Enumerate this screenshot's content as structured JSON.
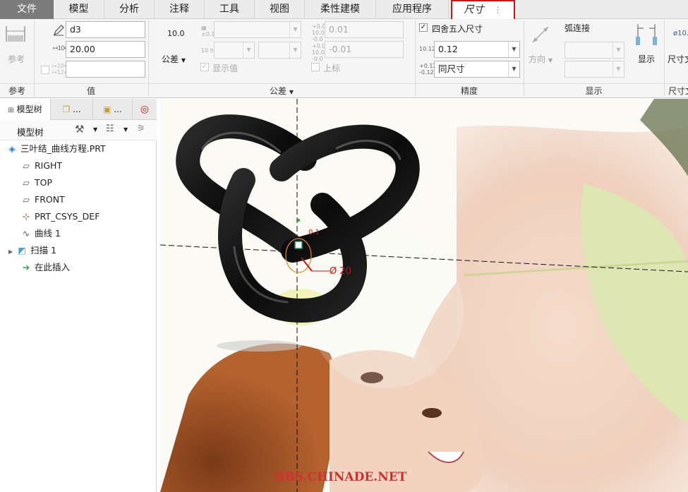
{
  "tabs": {
    "file": "文件",
    "model": "模型",
    "analysis": "分析",
    "annotate": "注释",
    "tools": "工具",
    "view": "视图",
    "flexible": "柔性建模",
    "apps": "应用程序",
    "dimension": "尺寸",
    "more": "⋮"
  },
  "ribbon": {
    "reference": {
      "button": "参考",
      "group": "参考"
    },
    "value": {
      "name": "d3",
      "value": "20.00",
      "group": "值"
    },
    "tolerance": {
      "nominal": "10.0",
      "button": "公差",
      "upper": "0.01",
      "lower": "-0.01",
      "show_value": "显示值",
      "upper_label": "上标",
      "group": "公差"
    },
    "precision": {
      "round_label": "四舍五入尺寸",
      "decimals": "0.12",
      "tol_decimals": "同尺寸",
      "group": "精度",
      "ico_a": "10.123",
      "ico_b": "+0.123\n-0.123"
    },
    "display": {
      "direction": "方向",
      "arc": "弧连接",
      "show_button": "显示",
      "group": "显示"
    },
    "dimtext": {
      "button": "尺寸文",
      "group": "尺寸文"
    }
  },
  "panel": {
    "tab_model_tree": "模型树",
    "tab2": "...",
    "tab3": "...",
    "toolbar_title": "模型树",
    "tree": [
      {
        "label": "三叶结_曲线方程.PRT",
        "icon": "part-icon"
      },
      {
        "label": "RIGHT",
        "icon": "plane-icon"
      },
      {
        "label": "TOP",
        "icon": "plane-icon"
      },
      {
        "label": "FRONT",
        "icon": "plane-icon"
      },
      {
        "label": "PRT_CSYS_DEF",
        "icon": "csys-icon"
      },
      {
        "label": "曲线 1",
        "icon": "curve-icon"
      },
      {
        "label": "扫描 1",
        "icon": "sweep-icon"
      },
      {
        "label": "在此插入",
        "icon": "insert-arrow-icon"
      }
    ]
  },
  "viewport": {
    "dim_label": "Ø 20",
    "dim_small": "0.1",
    "watermark": "BBS.CHINADE.NET"
  },
  "colors": {
    "accent_red": "#c8171b",
    "knot": "#111111",
    "dim": "#cc1111"
  }
}
